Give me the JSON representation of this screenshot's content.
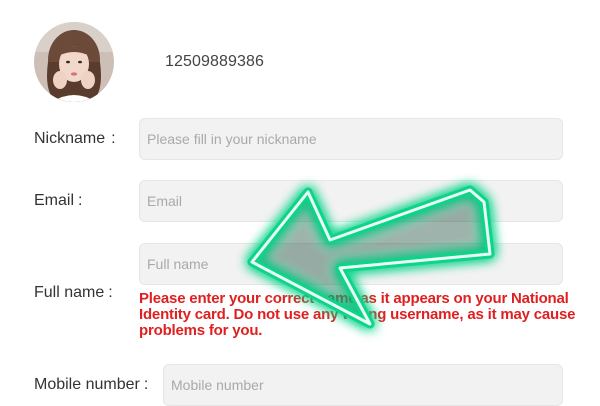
{
  "profile": {
    "phone": "12509889386"
  },
  "form": {
    "nickname": {
      "label": "Nickname",
      "colon": ":",
      "placeholder": "Please fill in your nickname",
      "value": ""
    },
    "email": {
      "label": "Email",
      "colon": ":",
      "placeholder": "Email",
      "value": ""
    },
    "full_name": {
      "label": "Full name",
      "colon": ":",
      "placeholder": "Full name",
      "value": "",
      "warning": "Please enter your correct name as it appears on your National Identity card. Do not use any wrong username, as it may cause problems for you."
    },
    "mobile": {
      "label": "Mobile number",
      "colon": ":",
      "placeholder": "Mobile number",
      "value": ""
    }
  },
  "colors": {
    "warning_text": "#e02020",
    "arrow_glow": "#14e08c",
    "field_bg": "#f2f2f2"
  },
  "annotation": {
    "icon": "pointing-arrow-icon"
  }
}
